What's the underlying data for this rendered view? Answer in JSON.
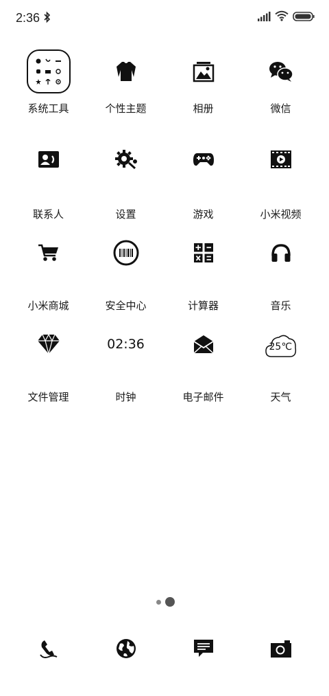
{
  "status_bar": {
    "time": "2:36",
    "bluetooth_icon": "bluetooth-icon",
    "signal_icon": "signal-icon",
    "wifi_icon": "wifi-icon",
    "battery_icon": "battery-icon"
  },
  "apps": [
    {
      "label": "系统工具",
      "icon": "folder-icon"
    },
    {
      "label": "个性主题",
      "icon": "shirt-icon"
    },
    {
      "label": "相册",
      "icon": "gallery-icon"
    },
    {
      "label": "微信",
      "icon": "wechat-icon"
    },
    {
      "label": "联系人",
      "icon": "contacts-icon"
    },
    {
      "label": "设置",
      "icon": "settings-icon"
    },
    {
      "label": "游戏",
      "icon": "gamepad-icon"
    },
    {
      "label": "小米视频",
      "icon": "video-icon"
    },
    {
      "label": "小米商城",
      "icon": "cart-icon"
    },
    {
      "label": "安全中心",
      "icon": "security-icon"
    },
    {
      "label": "计算器",
      "icon": "calculator-icon"
    },
    {
      "label": "音乐",
      "icon": "headphones-icon"
    },
    {
      "label": "文件管理",
      "icon": "diamond-icon"
    },
    {
      "label": "时钟",
      "icon": "clock-icon",
      "clock_time": "02:36"
    },
    {
      "label": "电子邮件",
      "icon": "mail-icon"
    },
    {
      "label": "天气",
      "icon": "weather-icon",
      "temperature": "25℃"
    }
  ],
  "page_indicator": {
    "pages": 2,
    "current": 2
  },
  "dock": [
    {
      "icon": "phone-icon"
    },
    {
      "icon": "browser-globe-icon"
    },
    {
      "icon": "messages-icon"
    },
    {
      "icon": "camera-icon"
    }
  ]
}
